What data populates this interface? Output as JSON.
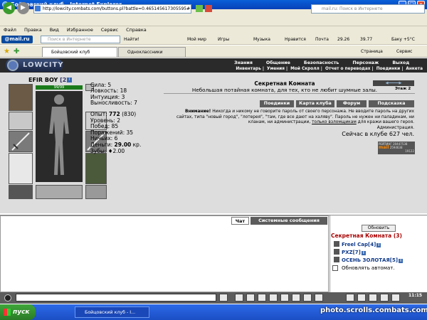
{
  "window": {
    "title": "Бойцовский клуб - Internet Explorer",
    "min": "_",
    "max": "□",
    "close": "x"
  },
  "address": {
    "url": "http://lowcity.combats.com/buttons.pl?battle=0.465145617305595#",
    "search_placeholder": "mail.ru: Поиск в Интернете"
  },
  "menu": [
    "Файл",
    "Правка",
    "Вид",
    "Избранное",
    "Сервис",
    "Справка"
  ],
  "mailbar": {
    "logo": "@mail.ru",
    "search_placeholder": "Поиск в Интернете",
    "find": "Найти!",
    "items": [
      "Мой мир",
      "Игры",
      "Музыка",
      "Нравится",
      "Почта",
      "29.26",
      "39.77",
      "Баку +5°C"
    ]
  },
  "tabs": [
    {
      "label": "Бойцовский клуб"
    },
    {
      "label": "Одноклассники"
    }
  ],
  "toolbar_right": {
    "page": "Страница",
    "service": "Сервис"
  },
  "game": {
    "logo": "LOWCITY",
    "nav_top": [
      "Знания",
      "Общение",
      "Безопасность",
      "Персонаж",
      "Выход"
    ],
    "nav_bottom": [
      "Инвентарь",
      "Умения",
      "Мой Скролл",
      "Отчет о переводах",
      "Поединки",
      "Анкета"
    ],
    "character": {
      "name": "EFIR BOY",
      "level": "[2]",
      "hp": "99/99"
    },
    "stats": [
      "Сила: 5",
      "Ловкость: 18",
      "Интуиция: 3",
      "Выносливость: 7"
    ],
    "exp": {
      "label": "Опыт:",
      "value": "772",
      "next": "(830)"
    },
    "stats2": [
      "Уровень: 2",
      "Побед: 85",
      "Поражений: 35",
      "Ничьих: 6"
    ],
    "money": {
      "label": "Деньги:",
      "value": "29.00",
      "unit": "кр."
    },
    "teeth": {
      "label": "Зубы:",
      "value": "2.00"
    },
    "room": {
      "title": "Секретная Комната",
      "desc": "Небольшая потайная комната, для тех, кто не любит шумные залы.",
      "floor": "Этаж 2"
    },
    "buttons": [
      "Поединки",
      "Карта клуба",
      "Форум",
      "Подсказка"
    ],
    "warning": {
      "bold": "Внимание!",
      "text1": "Никогда и никому не говорите пароль от своего персонажа. Не вводите пароль на других сайтах, типа \"новый город\", \"лотерея\", \"там, где все дают на халяву\". Пароль не нужен ни паладинам, ни кланам, ни администрации,",
      "link": "только взломщикам",
      "text2": "для кражи вашего героя."
    },
    "admin": "Администрация.",
    "online": "Сейчас в клубе 627 чел.",
    "counter": {
      "top": "РЕЙТИНГ 20447538",
      "brand": "mail",
      "nums": [
        "2594638",
        "19122"
      ]
    }
  },
  "chat": {
    "tab_chat": "Чат",
    "tab_system": "Системные сообщения",
    "refresh": "Обновить",
    "room_users_title": "Секретная Комната (3)",
    "users": [
      {
        "name": "Freel Cap",
        "level": "[4]"
      },
      {
        "name": "PXZ",
        "level": "[7]"
      },
      {
        "name": "ОСЕНЬ ЗОЛОТАЯ",
        "level": "[5]"
      }
    ],
    "auto_update": "Обновлять автомат.",
    "clock": "11:15"
  },
  "taskbar": {
    "start": "пуск",
    "task": "Бойцовский клуб - I...",
    "watermark": "photo.scrolls.combats.com"
  }
}
